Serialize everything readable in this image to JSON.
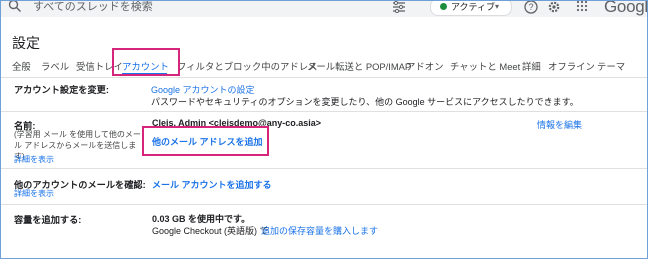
{
  "search": {
    "placeholder": "すべてのスレッドを検索"
  },
  "status": {
    "label": "アクティブ",
    "color": "#1e8e3e"
  },
  "brand": {
    "logo_text": "Google"
  },
  "page": {
    "title": "設定"
  },
  "tabs": [
    {
      "label": "全般",
      "active": false
    },
    {
      "label": "ラベル",
      "active": false
    },
    {
      "label": "受信トレイ",
      "active": false
    },
    {
      "label": "アカウント",
      "active": true
    },
    {
      "label": "フィルタとブロック中のアドレス",
      "active": false
    },
    {
      "label": "メール転送と POP/IMAP",
      "active": false
    },
    {
      "label": "アドオン",
      "active": false
    },
    {
      "label": "チャットと Meet",
      "active": false
    },
    {
      "label": "詳細",
      "active": false
    },
    {
      "label": "オフライン",
      "active": false
    },
    {
      "label": "テーマ",
      "active": false
    }
  ],
  "settings": {
    "change_account": {
      "label": "アカウント設定を変更:",
      "link": "Google アカウントの設定",
      "description": "パスワードやセキュリティのオプションを変更したり、他の Google サービスにアクセスしたりできます。"
    },
    "name": {
      "label": "名前:",
      "sub": "(学習用 メール を使用して他のメール アドレスからメールを送信します)",
      "detail_link": "詳細を表示",
      "value": "Cleis, Admin <cleisdemo@any-co.asia>",
      "edit_link": "情報を編集",
      "add_address_link": "他のメール アドレスを追加"
    },
    "check_mail": {
      "label": "他のアカウントのメールを確認:",
      "detail_link": "詳細を表示",
      "add_account_link": "メール アカウントを追加する"
    },
    "storage": {
      "label": "容量を追加する:",
      "usage": "0.03 GB を使用中です。",
      "checkout_text": "Google Checkout (英語版) で",
      "buy_link": "追加の保存容量を購入します"
    }
  },
  "colors": {
    "accent": "#1a73e8",
    "highlight": "#d6257a"
  }
}
